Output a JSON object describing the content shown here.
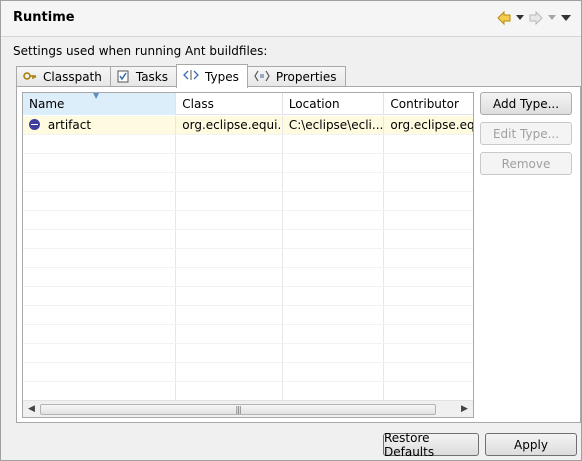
{
  "header": {
    "title": "Runtime",
    "back_icon": "back-arrow-icon",
    "forward_icon": "forward-arrow-icon",
    "menu_icon": "view-menu-icon"
  },
  "description": "Settings used when running Ant buildfiles:",
  "tabs": [
    {
      "label": "Classpath",
      "icon": "classpath-icon",
      "active": false
    },
    {
      "label": "Tasks",
      "icon": "tasks-icon",
      "active": false
    },
    {
      "label": "Types",
      "icon": "types-icon",
      "active": true
    },
    {
      "label": "Properties",
      "icon": "properties-icon",
      "active": false
    }
  ],
  "table": {
    "columns": [
      "Name",
      "Class",
      "Location",
      "Contributor"
    ],
    "rows": [
      [
        "artifact",
        "org.eclipse.equi...",
        "C:\\eclipse\\ecli...",
        "org.eclipse.eq..."
      ]
    ]
  },
  "side_buttons": {
    "add": "Add Type...",
    "edit": "Edit Type...",
    "remove": "Remove"
  },
  "footer": {
    "restore": "Restore Defaults",
    "apply": "Apply"
  },
  "colors": {
    "selected_row": "#fffbe0",
    "sorted_header": "#ddeefb",
    "back_arrow": "#e8b93a"
  }
}
